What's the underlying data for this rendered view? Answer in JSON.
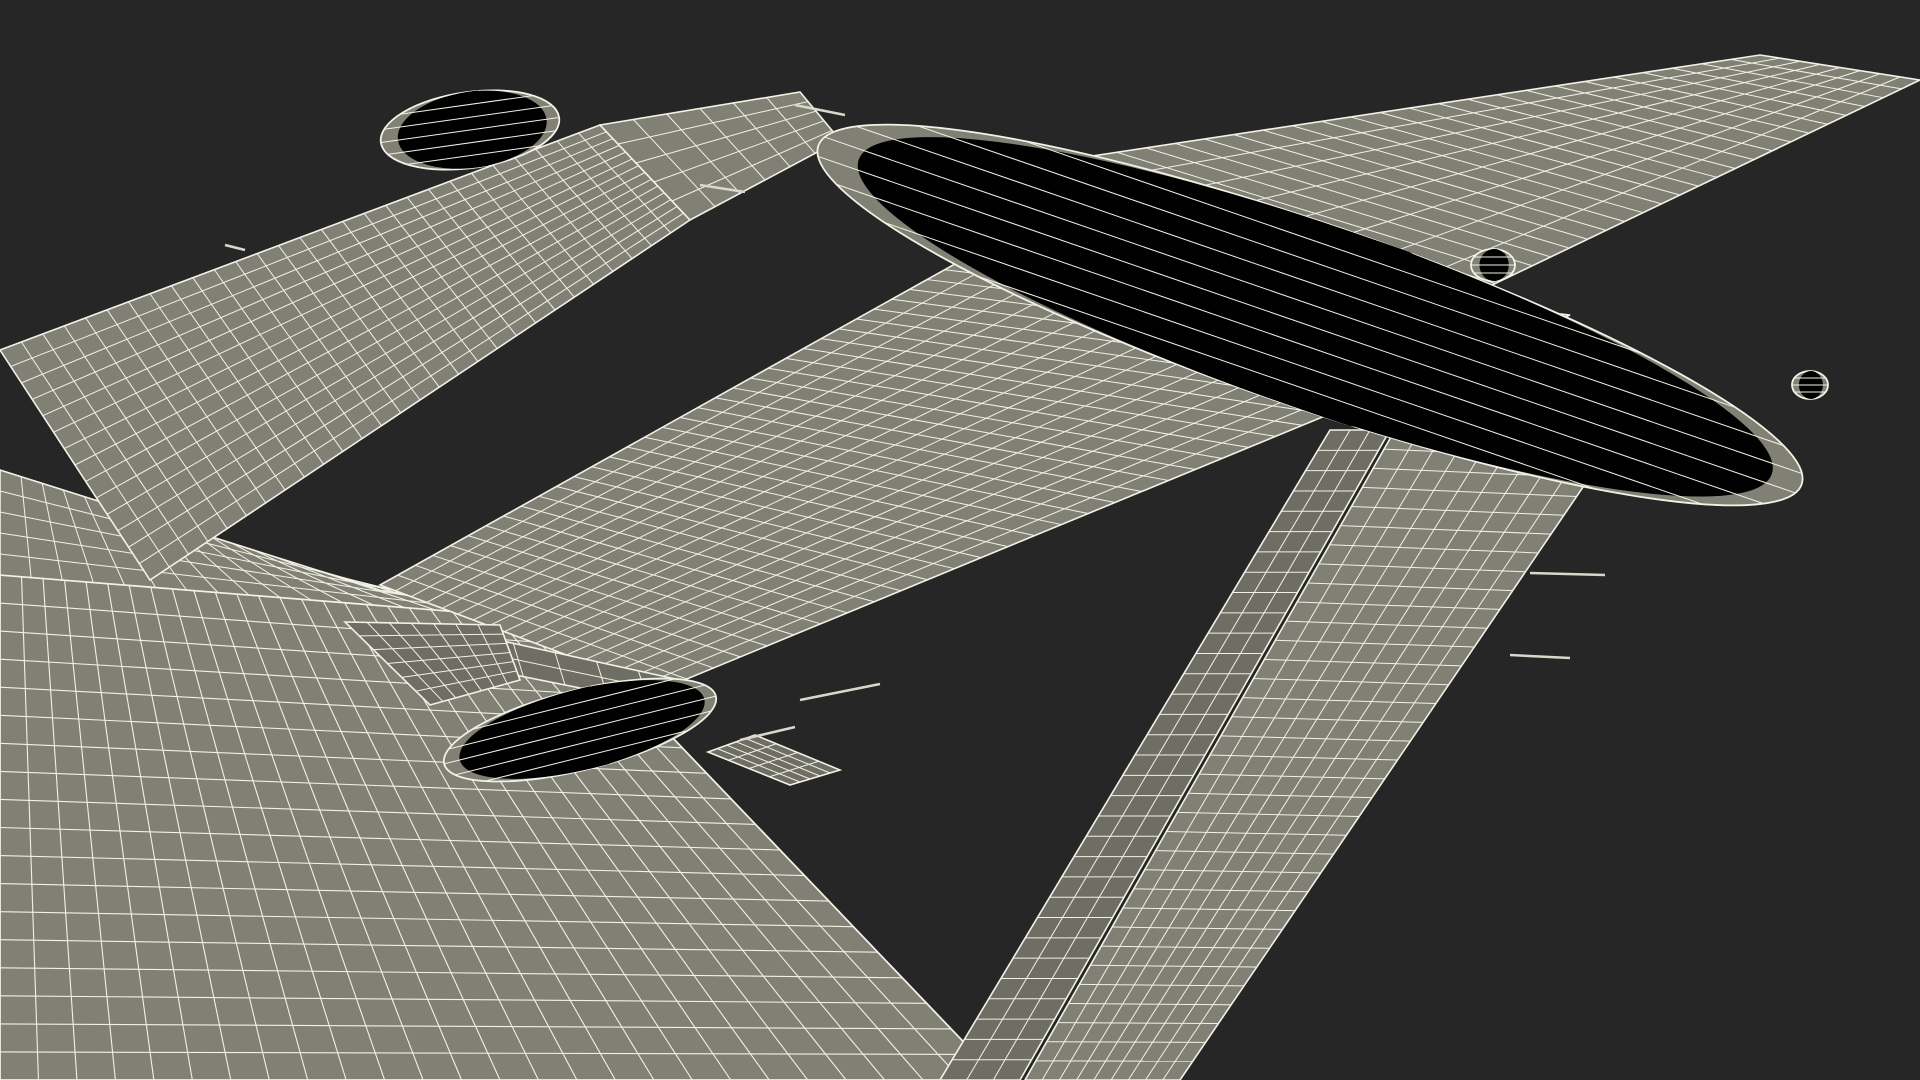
{
  "scene": {
    "background_color": "#262626",
    "surface_color": "#808075",
    "surface_shadow_color": "#6e6e64",
    "wire_color": "#f1f1e6",
    "render_style": "wireframe-over-shaded",
    "subject": "aircraft-wing-and-tail-close-up"
  }
}
